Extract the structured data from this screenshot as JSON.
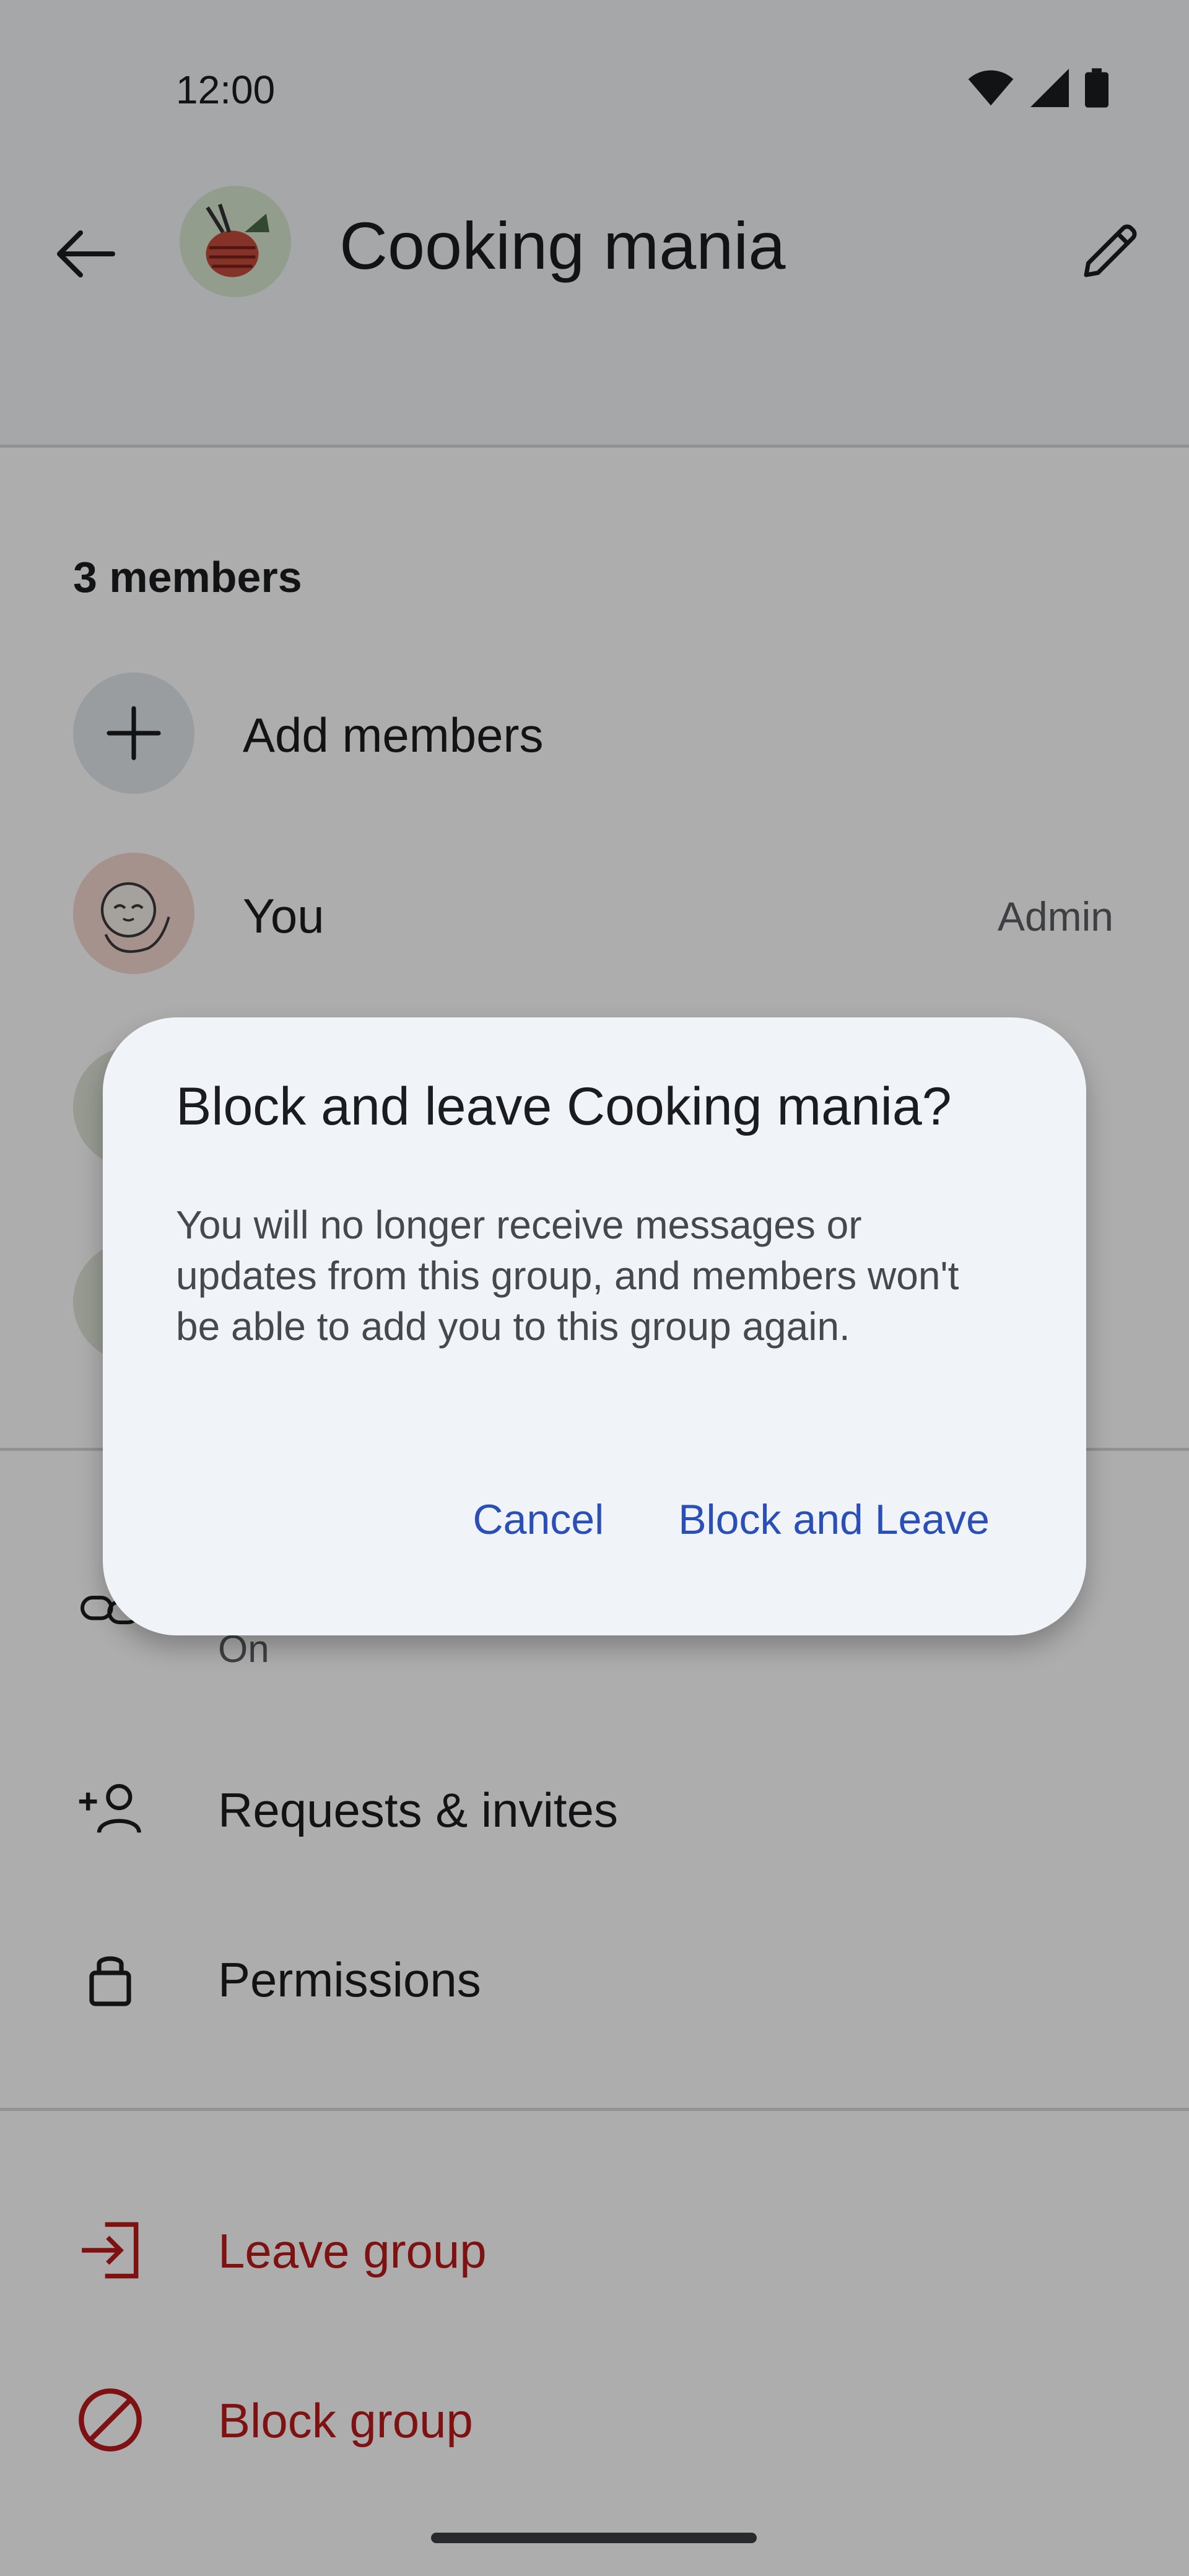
{
  "status_bar": {
    "time": "12:00"
  },
  "app_bar": {
    "title": "Cooking mania"
  },
  "members": {
    "count_label": "3 members",
    "add_label": "Add members",
    "items": [
      {
        "name": "You",
        "role": "Admin"
      }
    ]
  },
  "settings": {
    "group_link": {
      "sub": "On"
    },
    "requests_label": "Requests & invites",
    "permissions_label": "Permissions"
  },
  "danger": {
    "leave_label": "Leave group",
    "block_label": "Block group",
    "color": "#ba1a1a"
  },
  "dialog": {
    "title": "Block and leave Cooking mania?",
    "body": "You will no longer receive messages or updates from this group, and members won't be able to add you to this group again.",
    "cancel_label": "Cancel",
    "confirm_label": "Block and Leave",
    "accent": "#2b4fb8"
  },
  "icons": [
    "back-arrow-icon",
    "edit-pencil-icon",
    "plus-icon",
    "link-icon",
    "add-person-icon",
    "lock-icon",
    "leave-icon",
    "block-icon",
    "wifi-icon",
    "signal-icon",
    "battery-icon"
  ]
}
